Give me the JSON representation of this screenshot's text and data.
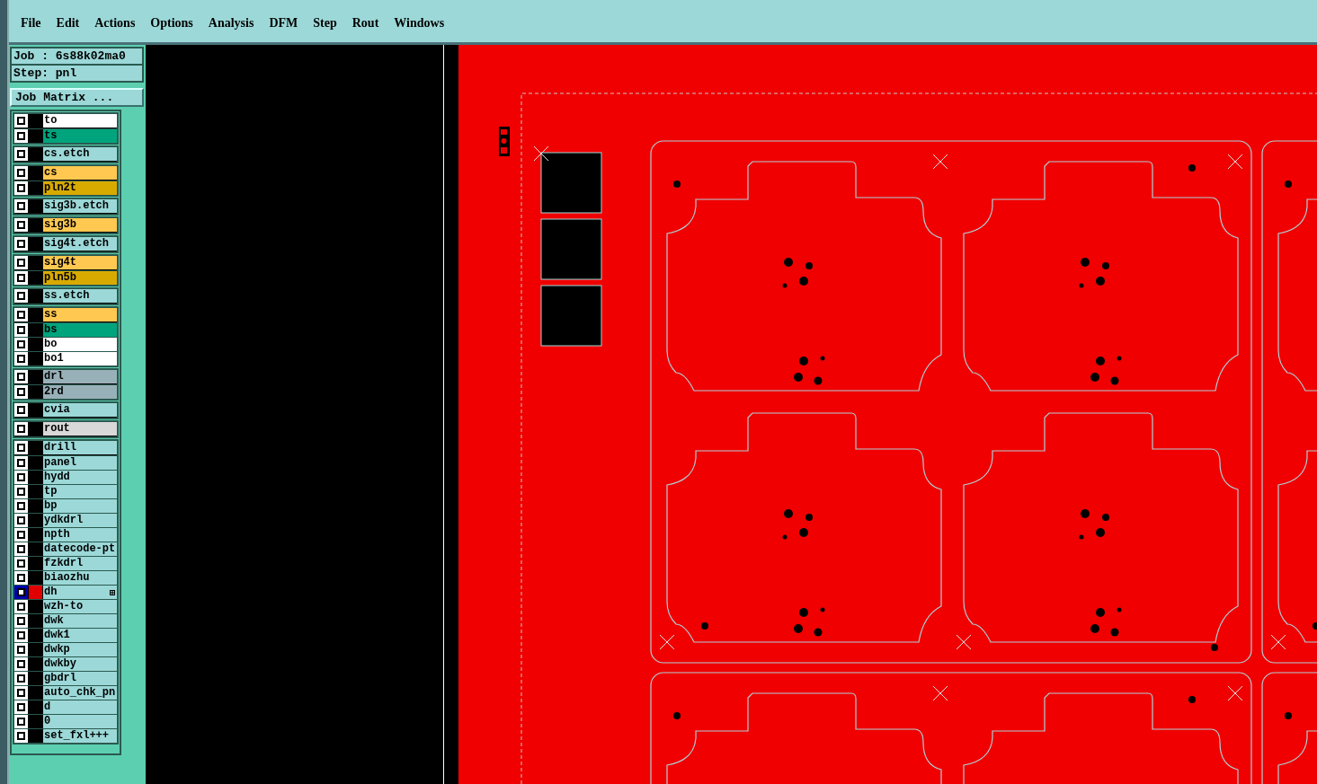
{
  "menu": [
    "File",
    "Edit",
    "Actions",
    "Options",
    "Analysis",
    "DFM",
    "Step",
    "Rout",
    "Windows"
  ],
  "job_label": "Job :  6s88k02ma0",
  "step_label": "Step: pnl",
  "job_matrix_button": "Job Matrix ...",
  "layer_groups": [
    [
      {
        "label": "to",
        "color": "#ffffff",
        "selected": false
      },
      {
        "label": "ts",
        "color": "#00a47c",
        "selected": false
      }
    ],
    [
      {
        "label": "cs.etch",
        "color": "#9cd8d8",
        "selected": false
      }
    ],
    [
      {
        "label": "cs",
        "color": "#ffc850",
        "selected": false
      },
      {
        "label": "pln2t",
        "color": "#d8aa00",
        "selected": false
      }
    ],
    [
      {
        "label": "sig3b.etch",
        "color": "#9cd8d8",
        "selected": false
      }
    ],
    [
      {
        "label": "sig3b",
        "color": "#ffc850",
        "selected": false
      }
    ],
    [
      {
        "label": "sig4t.etch",
        "color": "#9cd8d8",
        "selected": false
      }
    ],
    [
      {
        "label": "sig4t",
        "color": "#ffc850",
        "selected": false
      },
      {
        "label": "pln5b",
        "color": "#d8aa00",
        "selected": false
      }
    ],
    [
      {
        "label": "ss.etch",
        "color": "#9cd8d8",
        "selected": false
      }
    ],
    [
      {
        "label": "ss",
        "color": "#ffc850",
        "selected": false
      },
      {
        "label": "bs",
        "color": "#00a47c",
        "selected": false
      },
      {
        "label": "bo",
        "color": "#ffffff",
        "selected": false
      },
      {
        "label": "bo1",
        "color": "#ffffff",
        "selected": false
      }
    ],
    [
      {
        "label": "drl",
        "color": "#98b0b8",
        "selected": false
      },
      {
        "label": "2rd",
        "color": "#98b0b8",
        "selected": false
      }
    ],
    [
      {
        "label": "cvia",
        "color": "#9cd8d8",
        "selected": false
      }
    ],
    [
      {
        "label": "rout",
        "color": "#d8d8d8",
        "selected": false
      }
    ],
    [
      {
        "label": "drill",
        "color": "#9cd8d8",
        "selected": false
      },
      {
        "label": "panel",
        "color": "#9cd8d8",
        "selected": false
      },
      {
        "label": "hydd",
        "color": "#9cd8d8",
        "selected": false
      },
      {
        "label": "tp",
        "color": "#9cd8d8",
        "selected": false
      },
      {
        "label": "bp",
        "color": "#9cd8d8",
        "selected": false
      },
      {
        "label": "ydkdrl",
        "color": "#9cd8d8",
        "selected": false
      },
      {
        "label": "npth",
        "color": "#9cd8d8",
        "selected": false
      },
      {
        "label": "datecode-pt",
        "color": "#9cd8d8",
        "selected": false
      },
      {
        "label": "fzkdrl",
        "color": "#9cd8d8",
        "selected": false
      },
      {
        "label": "biaozhu",
        "color": "#9cd8d8",
        "selected": false
      },
      {
        "label": "dh",
        "color": "#9cd8d8",
        "selected": true
      },
      {
        "label": "wzh-to",
        "color": "#9cd8d8",
        "selected": false
      },
      {
        "label": "dwk",
        "color": "#9cd8d8",
        "selected": false
      },
      {
        "label": "dwk1",
        "color": "#9cd8d8",
        "selected": false
      },
      {
        "label": "dwkp",
        "color": "#9cd8d8",
        "selected": false
      },
      {
        "label": "dwkby",
        "color": "#9cd8d8",
        "selected": false
      },
      {
        "label": "gbdrl",
        "color": "#9cd8d8",
        "selected": false
      },
      {
        "label": "auto_chk_pn",
        "color": "#9cd8d8",
        "selected": false
      },
      {
        "label": "d",
        "color": "#9cd8d8",
        "selected": false
      },
      {
        "label": "0",
        "color": "#9cd8d8",
        "selected": false
      },
      {
        "label": "set_fxl+++",
        "color": "#9cd8d8",
        "selected": false
      }
    ]
  ]
}
